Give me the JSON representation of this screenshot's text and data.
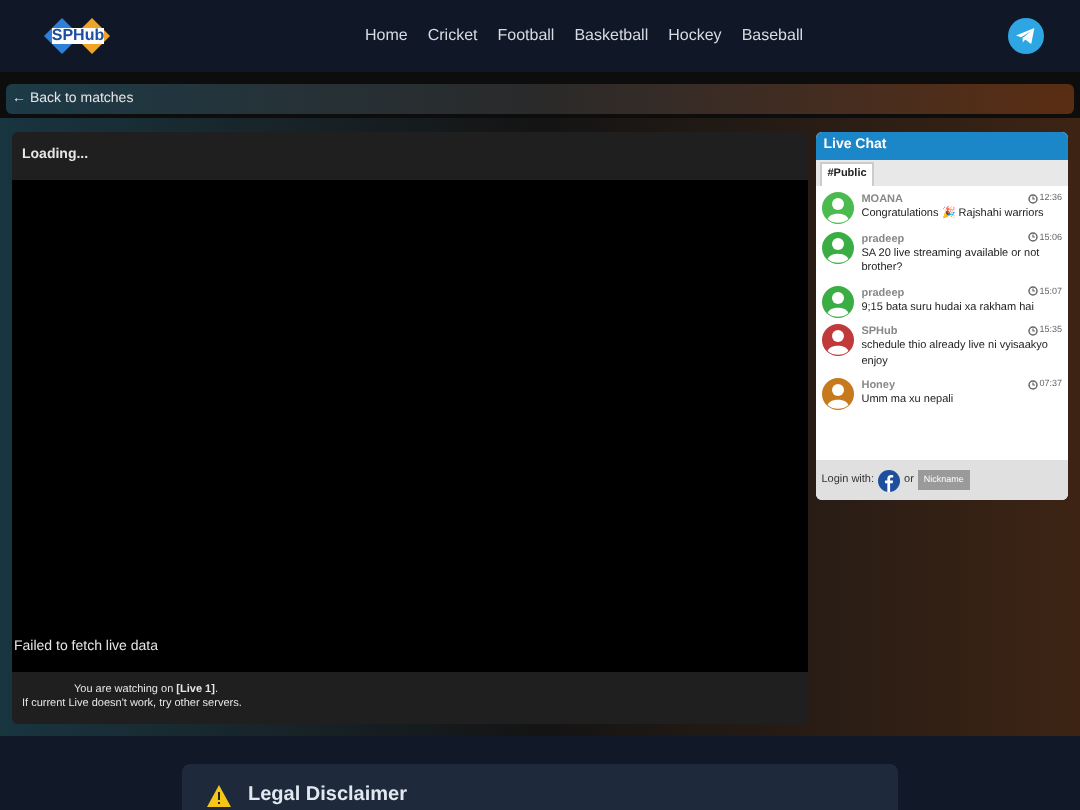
{
  "header": {
    "logo_text": "SPHub",
    "nav": [
      {
        "label": "Home"
      },
      {
        "label": "Cricket"
      },
      {
        "label": "Football"
      },
      {
        "label": "Basketball"
      },
      {
        "label": "Hockey"
      },
      {
        "label": "Baseball"
      }
    ]
  },
  "back_link": "← Back to matches",
  "player": {
    "title": "Loading...",
    "error": "Failed to fetch live data",
    "watching_prefix": "You are watching on ",
    "server": "[Live 1]",
    "watching_suffix": ".",
    "hint": "If current Live doesn't work, try other servers."
  },
  "chat": {
    "title": "Live Chat",
    "tabs": [
      {
        "label": "#Public",
        "selected": true
      }
    ],
    "messages": [
      {
        "user": "MOANA",
        "time": "12:36",
        "text": "Congratulations 🎉 Rajshahi warriors",
        "color": "#4cbb4f"
      },
      {
        "user": "pradeep",
        "time": "15:06",
        "text": "SA 20 live streaming available or not brother?",
        "color": "#3aae45"
      },
      {
        "user": "pradeep",
        "time": "15:07",
        "text": "9;15 bata suru hudai xa rakham hai",
        "color": "#3aae45"
      },
      {
        "user": "SPHub",
        "time": "15:35",
        "text": "schedule thio already live ni vyisaakyo enjoy",
        "color": "#c0393b"
      },
      {
        "user": "Honey",
        "time": "07:37",
        "text": "Umm ma xu nepali",
        "color": "#c77a1c"
      }
    ],
    "login_label": "Login with:",
    "or": "or",
    "nickname_button": "Nickname"
  },
  "disclaimer": {
    "title": "Legal Disclaimer"
  }
}
